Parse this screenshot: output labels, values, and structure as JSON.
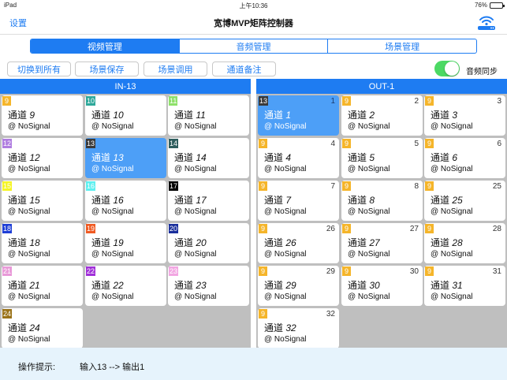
{
  "statusbar": {
    "device": "iPad",
    "time": "上午10:36",
    "battery": "76%",
    "battery_level": 0.76
  },
  "nav": {
    "left": "设置",
    "title": "宽博MVP矩阵控制器",
    "right_icon": "router-wifi-icon"
  },
  "tabs": [
    {
      "label": "视频管理",
      "active": true
    },
    {
      "label": "音频管理",
      "active": false
    },
    {
      "label": "场景管理",
      "active": false
    }
  ],
  "actions": [
    "切换到所有",
    "场景保存",
    "场景调用",
    "通道备注"
  ],
  "audio_sync": {
    "label": "音频同步",
    "on": true
  },
  "input_panel": {
    "title": "IN-13",
    "cells": [
      {
        "badge": "9",
        "color": "#f5b52a",
        "prefix": "通道",
        "ch": "9",
        "signal": "@ NoSignal",
        "selected": false
      },
      {
        "badge": "10",
        "color": "#2ea89a",
        "prefix": "通道",
        "ch": "10",
        "signal": "@ NoSignal",
        "selected": false
      },
      {
        "badge": "11",
        "color": "#8ee06a",
        "prefix": "通道",
        "ch": "11",
        "signal": "@ NoSignal",
        "selected": false
      },
      {
        "badge": "12",
        "color": "#b07ee0",
        "prefix": "通道",
        "ch": "12",
        "signal": "@ NoSignal",
        "selected": false
      },
      {
        "badge": "13",
        "color": "#3a3a3a",
        "prefix": "通道",
        "ch": "13",
        "signal": "@ NoSignal",
        "selected": true
      },
      {
        "badge": "14",
        "color": "#2f5e5e",
        "prefix": "通道",
        "ch": "14",
        "signal": "@ NoSignal",
        "selected": false
      },
      {
        "badge": "15",
        "color": "#f5f525",
        "prefix": "通道",
        "ch": "15",
        "signal": "@ NoSignal",
        "selected": false
      },
      {
        "badge": "16",
        "color": "#5ff0f0",
        "prefix": "通道",
        "ch": "16",
        "signal": "@ NoSignal",
        "selected": false
      },
      {
        "badge": "17",
        "color": "#000000",
        "prefix": "通道",
        "ch": "17",
        "signal": "@ NoSignal",
        "selected": false
      },
      {
        "badge": "18",
        "color": "#1f3fd6",
        "prefix": "通道",
        "ch": "18",
        "signal": "@ NoSignal",
        "selected": false
      },
      {
        "badge": "19",
        "color": "#f05a22",
        "prefix": "通道",
        "ch": "19",
        "signal": "@ NoSignal",
        "selected": false
      },
      {
        "badge": "20",
        "color": "#1a2f9c",
        "prefix": "通道",
        "ch": "20",
        "signal": "@ NoSignal",
        "selected": false
      },
      {
        "badge": "21",
        "color": "#e89ad8",
        "prefix": "通道",
        "ch": "21",
        "signal": "@ NoSignal",
        "selected": false
      },
      {
        "badge": "22",
        "color": "#a030d8",
        "prefix": "通道",
        "ch": "22",
        "signal": "@ NoSignal",
        "selected": false
      },
      {
        "badge": "23",
        "color": "#f2a6e2",
        "prefix": "通道",
        "ch": "23",
        "signal": "@ NoSignal",
        "selected": false
      },
      {
        "badge": "24",
        "color": "#9a7218",
        "prefix": "通道",
        "ch": "24",
        "signal": "@ NoSignal",
        "selected": false
      }
    ]
  },
  "output_panel": {
    "title": "OUT-1",
    "cells": [
      {
        "badge": "13",
        "color": "#3a3a3a",
        "num": "1",
        "prefix": "通道",
        "ch": "1",
        "signal": "@ NoSignal",
        "selected": true
      },
      {
        "badge": "9",
        "color": "#f5b52a",
        "num": "2",
        "prefix": "通道",
        "ch": "2",
        "signal": "@ NoSignal",
        "selected": false
      },
      {
        "badge": "9",
        "color": "#f5b52a",
        "num": "3",
        "prefix": "通道",
        "ch": "3",
        "signal": "@ NoSignal",
        "selected": false
      },
      {
        "badge": "9",
        "color": "#f5b52a",
        "num": "4",
        "prefix": "通道",
        "ch": "4",
        "signal": "@ NoSignal",
        "selected": false
      },
      {
        "badge": "9",
        "color": "#f5b52a",
        "num": "5",
        "prefix": "通道",
        "ch": "5",
        "signal": "@ NoSignal",
        "selected": false
      },
      {
        "badge": "9",
        "color": "#f5b52a",
        "num": "6",
        "prefix": "通道",
        "ch": "6",
        "signal": "@ NoSignal",
        "selected": false
      },
      {
        "badge": "9",
        "color": "#f5b52a",
        "num": "7",
        "prefix": "通道",
        "ch": "7",
        "signal": "@ NoSignal",
        "selected": false
      },
      {
        "badge": "9",
        "color": "#f5b52a",
        "num": "8",
        "prefix": "通道",
        "ch": "8",
        "signal": "@ NoSignal",
        "selected": false
      },
      {
        "badge": "9",
        "color": "#f5b52a",
        "num": "25",
        "prefix": "通道",
        "ch": "25",
        "signal": "@ NoSignal",
        "selected": false
      },
      {
        "badge": "9",
        "color": "#f5b52a",
        "num": "26",
        "prefix": "通道",
        "ch": "26",
        "signal": "@ NoSignal",
        "selected": false
      },
      {
        "badge": "9",
        "color": "#f5b52a",
        "num": "27",
        "prefix": "通道",
        "ch": "27",
        "signal": "@ NoSignal",
        "selected": false
      },
      {
        "badge": "9",
        "color": "#f5b52a",
        "num": "28",
        "prefix": "通道",
        "ch": "28",
        "signal": "@ NoSignal",
        "selected": false
      },
      {
        "badge": "9",
        "color": "#f5b52a",
        "num": "29",
        "prefix": "通道",
        "ch": "29",
        "signal": "@ NoSignal",
        "selected": false
      },
      {
        "badge": "9",
        "color": "#f5b52a",
        "num": "30",
        "prefix": "通道",
        "ch": "30",
        "signal": "@ NoSignal",
        "selected": false
      },
      {
        "badge": "9",
        "color": "#f5b52a",
        "num": "31",
        "prefix": "通道",
        "ch": "31",
        "signal": "@ NoSignal",
        "selected": false
      },
      {
        "badge": "9",
        "color": "#f5b52a",
        "num": "32",
        "prefix": "通道",
        "ch": "32",
        "signal": "@ NoSignal",
        "selected": false
      }
    ]
  },
  "footer": {
    "label": "操作提示:",
    "message": "输入13 --> 输出1"
  },
  "colors": {
    "accent": "#1e7cf2",
    "selected_cell": "#4d9ff7",
    "toggle_on": "#4cd964",
    "footer_bg": "#e6f3fc"
  }
}
